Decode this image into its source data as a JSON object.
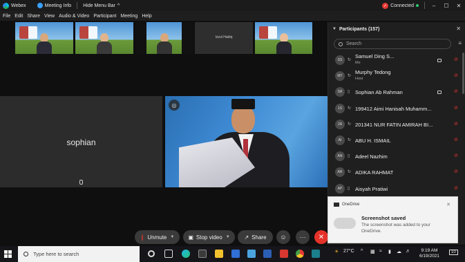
{
  "titlebar": {
    "app_name": "Webex",
    "meeting_info": "Meeting Info",
    "hide_menu_bar": "Hide Menu Bar",
    "connected": "Connected",
    "window_controls": [
      "–",
      "☐",
      "✕"
    ]
  },
  "menu": [
    "File",
    "Edit",
    "Share",
    "View",
    "Audio & Video",
    "Participant",
    "Meeting",
    "Help"
  ],
  "filmstrip": {
    "dark_tile_label": "Izzul Hadiq"
  },
  "main": {
    "sophian_name": "sophian"
  },
  "controls": {
    "unmute": "Unmute",
    "stop_video": "Stop video",
    "share": "Share",
    "more": "···",
    "leave": "✕"
  },
  "participants": {
    "header": "Participants (157)",
    "search_placeholder": "Search",
    "list": [
      {
        "initials": "SS",
        "name": "Samuel Ding S...",
        "role": "Me",
        "device": "↻",
        "camera": true
      },
      {
        "initials": "MT",
        "name": "Murphy Tedong",
        "role": "Host",
        "device": "↻",
        "camera": false
      },
      {
        "initials": "SR",
        "name": "Sophian Ab Rahman",
        "role": "",
        "device": "▯",
        "camera": true
      },
      {
        "initials": "1S",
        "name": "199412 Aimi Hanisah Muhamm...",
        "role": "",
        "device": "↻",
        "camera": false
      },
      {
        "initials": "2A",
        "name": "201341 NUR FATIN AMIRAH BI...",
        "role": "",
        "device": "↻",
        "camera": false
      },
      {
        "initials": "AI",
        "name": "ABU H. ISMAIL",
        "role": "",
        "device": "↻",
        "camera": false
      },
      {
        "initials": "AN",
        "name": "Adeel Nazhim",
        "role": "",
        "device": "▯",
        "camera": false
      },
      {
        "initials": "AR",
        "name": "ADIKA RAHMAT",
        "role": "",
        "device": "↻",
        "camera": false
      },
      {
        "initials": "AP",
        "name": "Aisyah Pratiwi",
        "role": "",
        "device": "▯",
        "camera": false
      }
    ]
  },
  "toast": {
    "app": "OneDrive",
    "title": "Screenshot saved",
    "body": "The screenshot was added to your OneDrive."
  },
  "taskbar": {
    "search_placeholder": "Type here to search",
    "temperature": "27°C",
    "time": "9:19 AM",
    "date": "6/19/2021",
    "notifications": "10",
    "language": "ENG"
  },
  "colors": {
    "leave_red": "#e5332a",
    "mute_red": "#e5332a",
    "panel_bg": "#1f1f1f"
  }
}
